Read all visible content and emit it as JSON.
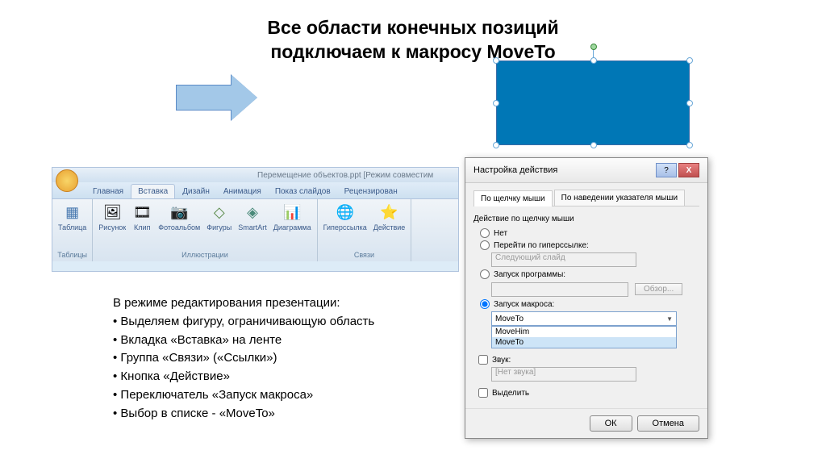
{
  "title_line1": "Все области конечных позиций",
  "title_line2": "подключаем к макросу MoveTo",
  "ppt": {
    "window_title": "Перемещение объектов.ppt [Режим совместим",
    "tabs": {
      "home": "Главная",
      "insert": "Вставка",
      "design": "Дизайн",
      "animation": "Анимация",
      "slideshow": "Показ слайдов",
      "review": "Рецензирован"
    },
    "groups": {
      "tables": "Таблицы",
      "illustrations": "Иллюстрации",
      "links": "Связи"
    },
    "buttons": {
      "table": "Таблица",
      "picture": "Рисунок",
      "clip": "Клип",
      "album": "Фотоальбом",
      "shapes": "Фигуры",
      "smartart": "SmartArt",
      "chart": "Диаграмма",
      "hyperlink": "Гиперссылка",
      "action": "Действие"
    }
  },
  "dialog": {
    "title": "Настройка действия",
    "tabs": {
      "click": "По щелчку мыши",
      "hover": "По наведении указателя мыши"
    },
    "section": "Действие по щелчку мыши",
    "options": {
      "none": "Нет",
      "hyperlink": "Перейти по гиперссылке:",
      "hyperlink_value": "Следующий слайд",
      "program": "Запуск программы:",
      "browse": "Обзор...",
      "macro": "Запуск макроса:",
      "macro_value": "MoveTo",
      "macro_options": [
        "MoveHim",
        "MoveTo"
      ]
    },
    "sound": "Звук:",
    "sound_value": "[Нет звука]",
    "highlight": "Выделить",
    "ok": "ОК",
    "cancel": "Отмена"
  },
  "instructions": {
    "intro": "В режиме редактирования презентации:",
    "items": [
      "• Выделяем фигуру, ограничивающую область",
      "• Вкладка «Вставка» на ленте",
      "• Группа «Связи» («Ссылки»)",
      "• Кнопка «Действие»",
      "• Переключатель «Запуск макроса»",
      "• Выбор в списке - «MoveTo»"
    ]
  }
}
